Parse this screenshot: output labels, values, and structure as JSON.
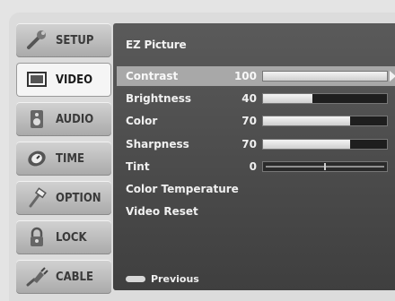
{
  "menu": {
    "tabs": [
      {
        "label": "SETUP",
        "icon": "wrench-icon",
        "active": false
      },
      {
        "label": "VIDEO",
        "icon": "monitor-icon",
        "active": true
      },
      {
        "label": "AUDIO",
        "icon": "speaker-icon",
        "active": false
      },
      {
        "label": "TIME",
        "icon": "clock-icon",
        "active": false
      },
      {
        "label": "OPTION",
        "icon": "hammer-icon",
        "active": false
      },
      {
        "label": "LOCK",
        "icon": "padlock-icon",
        "active": false
      },
      {
        "label": "CABLE",
        "icon": "cable-plug-icon",
        "active": false
      }
    ]
  },
  "video": {
    "title": "EZ Picture",
    "settings": [
      {
        "label": "Contrast",
        "value": "100",
        "level": 1.0,
        "selected": true
      },
      {
        "label": "Brightness",
        "value": "40",
        "level": 0.4
      },
      {
        "label": "Color",
        "value": "70",
        "level": 0.7
      },
      {
        "label": "Sharpness",
        "value": "70",
        "level": 0.7
      },
      {
        "label": "Tint",
        "value": "0",
        "level": 0.5
      }
    ],
    "color_temperature": "Color Temperature",
    "video_reset": "Video Reset",
    "footer": "Previous"
  }
}
